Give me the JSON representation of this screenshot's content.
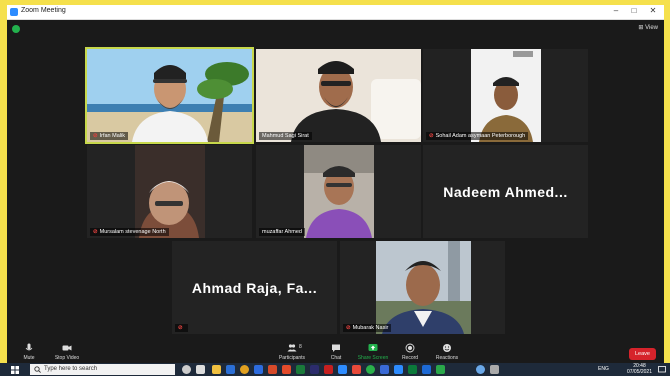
{
  "window": {
    "title": "Zoom Meeting"
  },
  "stage": {
    "view_label": "View"
  },
  "participants": [
    {
      "name": "Irfan Malik",
      "tile": "video-1"
    },
    {
      "name": "Mahmud Sagi Sirat",
      "tile": "video-2"
    },
    {
      "name": "Sohail Adam asymaan Peterborough",
      "tile": "video-3"
    },
    {
      "name": "Mursalam stevenage North",
      "tile": "video-4"
    },
    {
      "name": "muzaffar Ahmed",
      "tile": "video-5"
    },
    {
      "name": "Nadeem Ahmed...",
      "tile": "name-only"
    },
    {
      "name": "Ahmad Raja, Fa...",
      "tile": "name-only"
    },
    {
      "name": "Mubarak Nasir",
      "tile": "video-6"
    }
  ],
  "toolbar": {
    "mute": "Mute",
    "stop_video": "Stop Video",
    "participants": "Participants",
    "participants_count": "8",
    "chat": "Chat",
    "share_screen": "Share Screen",
    "record": "Record",
    "reactions": "Reactions",
    "leave": "Leave"
  },
  "taskbar": {
    "search_placeholder": "Type here to search",
    "language": "ENG",
    "time": "20:48",
    "date": "07/05/2021"
  },
  "colors": {
    "active_speaker": "#c7d84b",
    "leave": "#d6232b",
    "share": "#23b14d"
  }
}
